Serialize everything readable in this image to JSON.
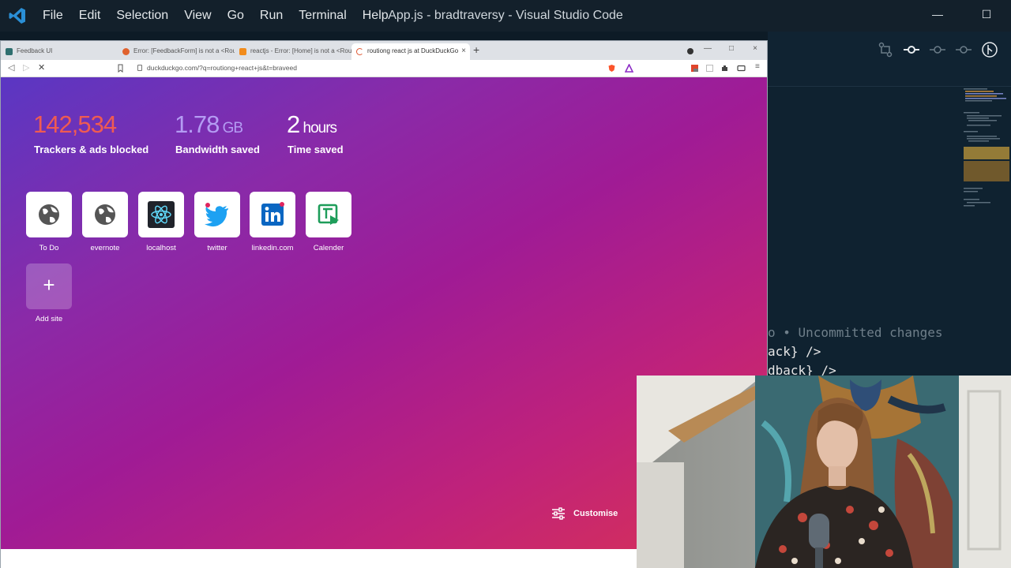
{
  "vscode": {
    "menu": [
      "File",
      "Edit",
      "Selection",
      "View",
      "Go",
      "Run",
      "Terminal",
      "Help"
    ],
    "title": "App.js - bradtraversy - Visual Studio Code",
    "window_controls": [
      "—",
      "☐"
    ],
    "code_lines": [
      "o • Uncommitted changes",
      "ack} />",
      "dback} />"
    ]
  },
  "browser": {
    "tabs": [
      {
        "label": "Feedback UI",
        "color": "#2f6f6f"
      },
      {
        "label": "Error: [FeedbackForm] is not a <Route>",
        "color": "#e0622e"
      },
      {
        "label": "reactjs - Error: [Home] is not a <Route>",
        "color": "#f28c1c"
      },
      {
        "label": "routiong react js at DuckDuckGo",
        "color": "#de5833"
      }
    ],
    "new_tab_symbol": "+",
    "close_symbol": "×",
    "window_controls": [
      "—",
      "□",
      "×"
    ],
    "url": "duckduckgo.com/?q=routiong+react+js&t=braveed"
  },
  "newtab": {
    "stats": [
      {
        "value": "142,534",
        "unit": "",
        "label": "Trackers & ads blocked",
        "color": "#ef5b52"
      },
      {
        "value": "1.78",
        "unit": " GB",
        "label": "Bandwidth saved",
        "color": "#b49cf3"
      },
      {
        "value": "2",
        "unit": " hours",
        "label": "Time saved",
        "color": "#ffffff"
      }
    ],
    "tiles": [
      {
        "label": "To Do",
        "icon": "globe-icon"
      },
      {
        "label": "evernote",
        "icon": "globe-icon"
      },
      {
        "label": "localhost",
        "icon": "react-icon"
      },
      {
        "label": "twitter",
        "icon": "twitter-icon"
      },
      {
        "label": "linkedin.com",
        "icon": "linkedin-icon"
      },
      {
        "label": "Calender",
        "icon": "calendar-icon"
      }
    ],
    "add_site": {
      "symbol": "+",
      "label": "Add site"
    },
    "customise_label": "Customise"
  }
}
